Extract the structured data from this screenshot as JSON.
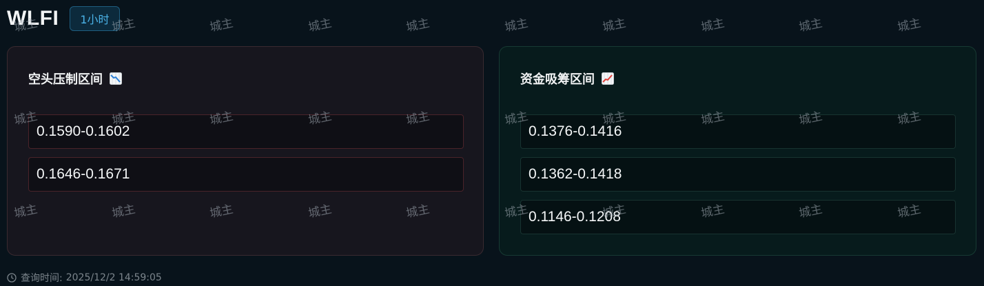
{
  "header": {
    "symbol": "WLFI",
    "timeframe": "1小时"
  },
  "short_panel": {
    "title": "空头压制区间",
    "icon": "chart-decreasing-icon",
    "ranges": [
      "0.1590-0.1602",
      "0.1646-0.1671"
    ]
  },
  "long_panel": {
    "title": "资金吸筹区间",
    "icon": "chart-increasing-icon",
    "ranges": [
      "0.1376-0.1416",
      "0.1362-0.1418",
      "0.1146-0.1208"
    ]
  },
  "footer": {
    "label": "查询时间:",
    "time": "2025/12/2 14:59:05"
  },
  "watermark": "城主",
  "colors": {
    "background": "#08131b",
    "short_panel_bg": "#17161e",
    "long_panel_bg": "#071b1c",
    "timeframe_accent": "#4bb3e8"
  }
}
